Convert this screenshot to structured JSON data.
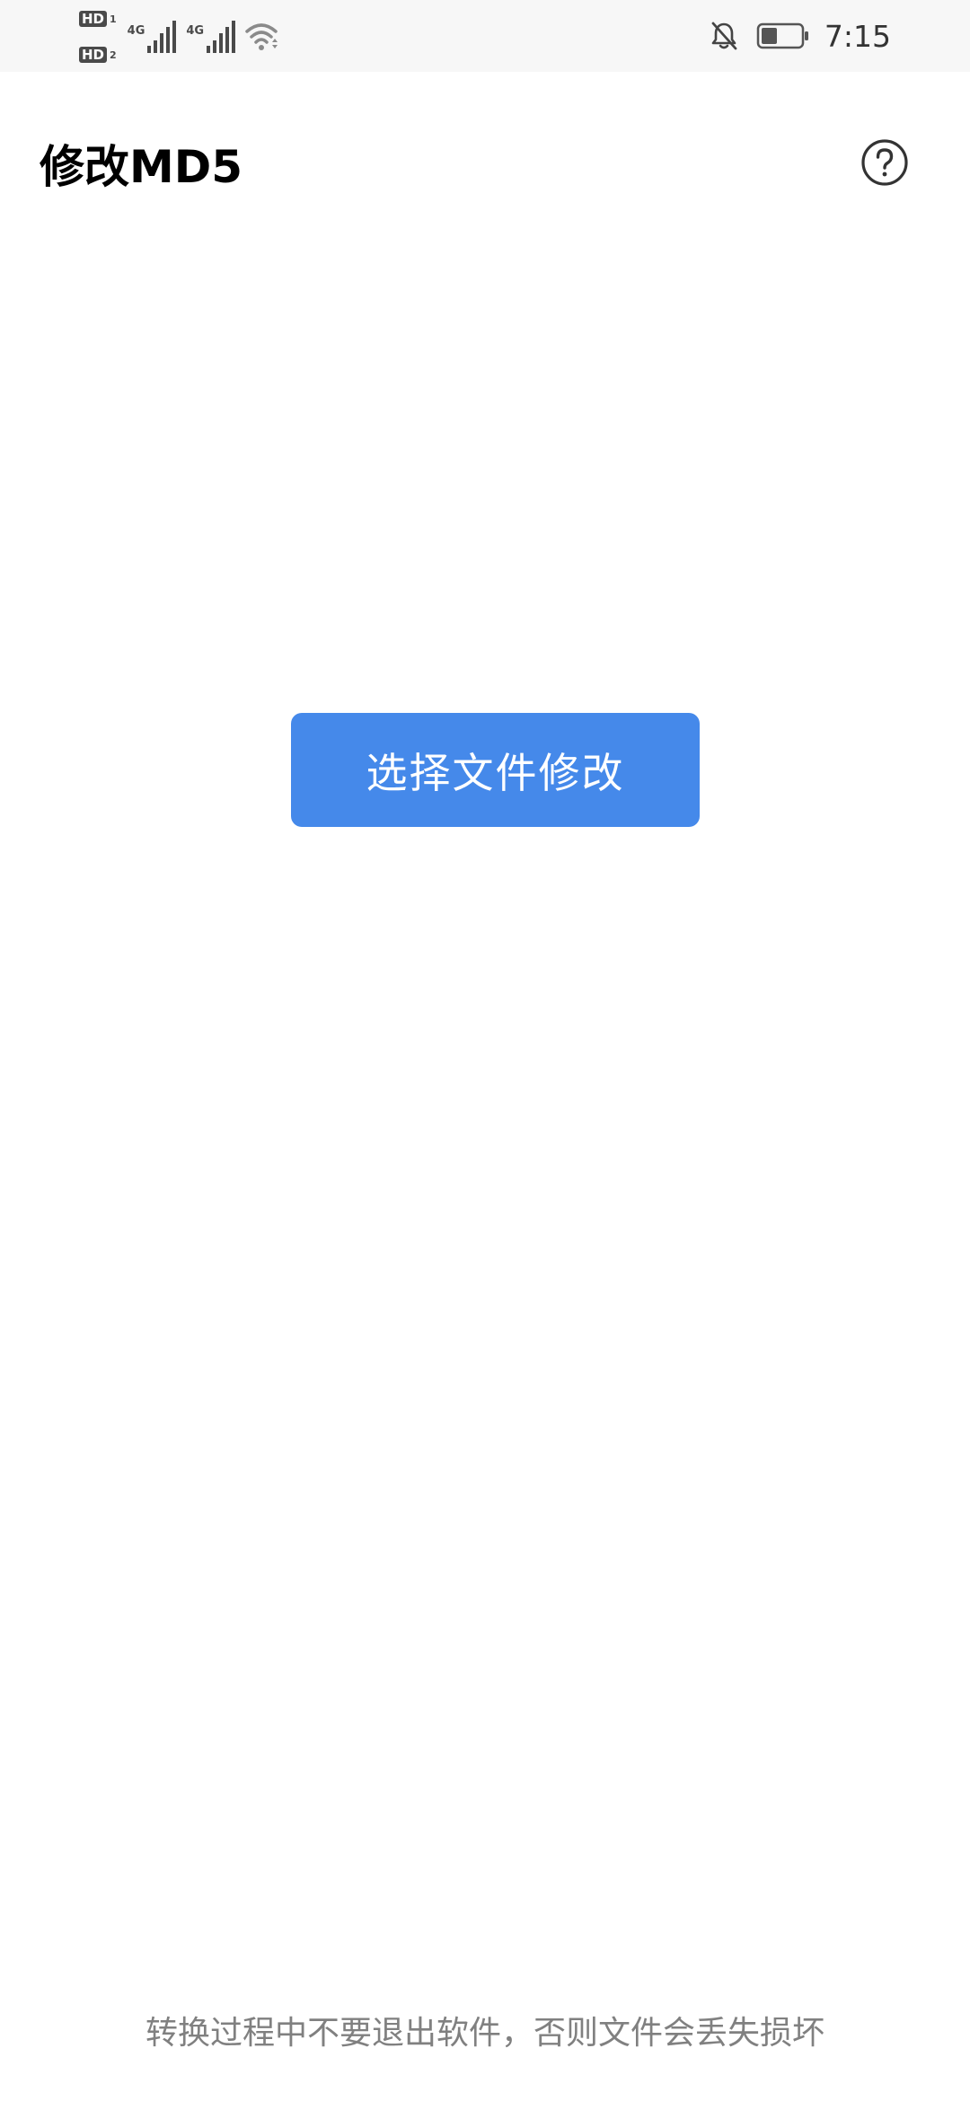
{
  "status_bar": {
    "sim1_badge": "HD",
    "sim1_num": "1",
    "sim2_badge": "HD",
    "sim2_num": "2",
    "signal1_label": "4G",
    "signal2_label": "4G",
    "time": "7:15",
    "battery_level": 0.4,
    "icons": [
      "signal-icon",
      "signal-icon",
      "wifi-icon",
      "bell-off-icon",
      "battery-icon"
    ]
  },
  "header": {
    "title": "修改MD5",
    "help_icon": "question-circle-icon"
  },
  "main": {
    "select_button_label": "选择文件修改"
  },
  "footer": {
    "warning": "转换过程中不要退出软件，否则文件会丢失损坏"
  },
  "colors": {
    "accent": "#4589ea",
    "status_bar_bg": "#f7f7f7",
    "footer_text": "#808080"
  }
}
